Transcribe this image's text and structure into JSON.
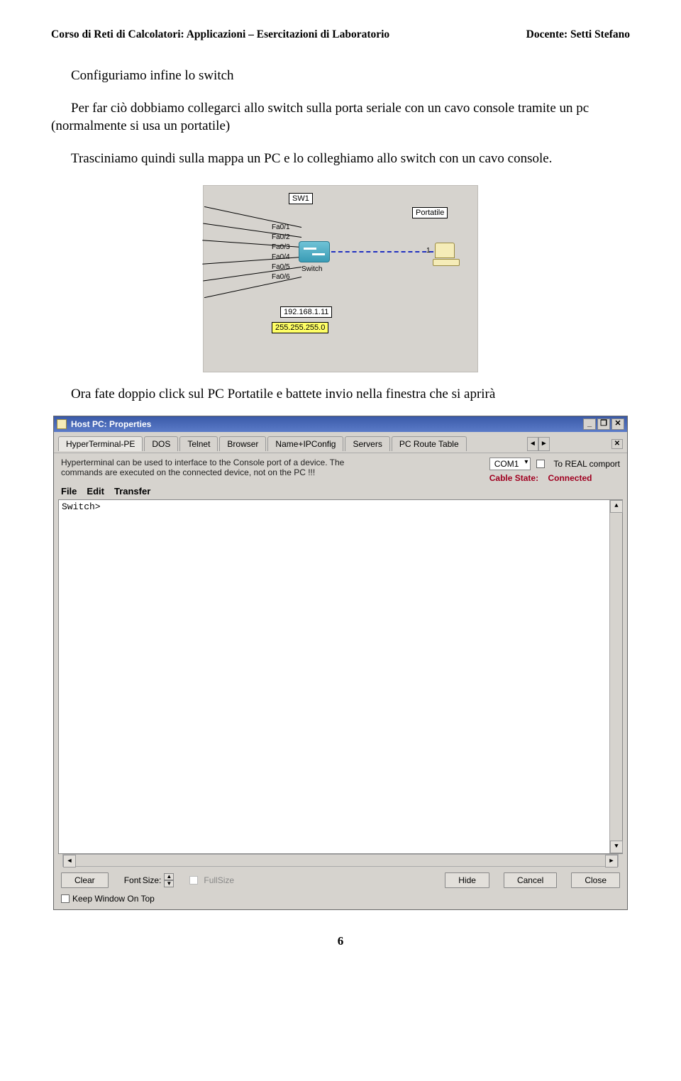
{
  "header": {
    "left": "Corso di Reti di Calcolatori: Applicazioni – Esercitazioni di Laboratorio",
    "right": "Docente: Setti  Stefano"
  },
  "paragraphs": {
    "p1": "Configuriamo infine lo switch",
    "p2": "Per far ciò dobbiamo collegarci allo switch sulla porta seriale con un cavo console tramite un pc (normalmente si usa un portatile)",
    "p3": "Trasciniamo quindi sulla mappa un PC e lo colleghiamo allo switch con un cavo console.",
    "p4": "Ora fate doppio click sul PC Portatile e battete invio nella finestra che si aprirà"
  },
  "diagram": {
    "sw1": "SW1",
    "portatile": "Portatile",
    "switch_label": "Switch",
    "fa": [
      "Fa0/1",
      "Fa0/2",
      "Fa0/3",
      "Fa0/4",
      "Fa0/5",
      "Fa0/6"
    ],
    "one": "1",
    "ip": "192.168.1.11",
    "mask": "255.255.255.0"
  },
  "window": {
    "title": "Host PC: Properties",
    "min": "_",
    "restore": "❐",
    "close": "✕",
    "tabs": {
      "hyper": "HyperTerminal-PE",
      "dos": "DOS",
      "telnet": "Telnet",
      "browser": "Browser",
      "ipcfg": "Name+IPConfig",
      "servers": "Servers",
      "route": "PC Route Table"
    },
    "arrows": {
      "left": "◄",
      "right": "►",
      "x": "✕"
    },
    "hint1": "Hyperterminal can be used to interface to the Console port of a device. The",
    "hint2": "commands are executed on the connected device, not on the PC !!!",
    "com": "COM1",
    "realcom": "To REAL comport",
    "cable_label": "Cable State:",
    "cable_state": "Connected",
    "menu": {
      "file": "File",
      "edit": "Edit",
      "transfer": "Transfer"
    },
    "prompt": "Switch>",
    "btn_clear": "Clear",
    "font_label": "Font",
    "size_label": "Size:",
    "fullsize": "FullSize",
    "btn_hide": "Hide",
    "btn_cancel": "Cancel",
    "btn_close": "Close",
    "keep_on_top": "Keep Window On Top",
    "up": "▲",
    "down": "▼",
    "sleft": "◄",
    "sright": "►"
  },
  "page_number": "6"
}
